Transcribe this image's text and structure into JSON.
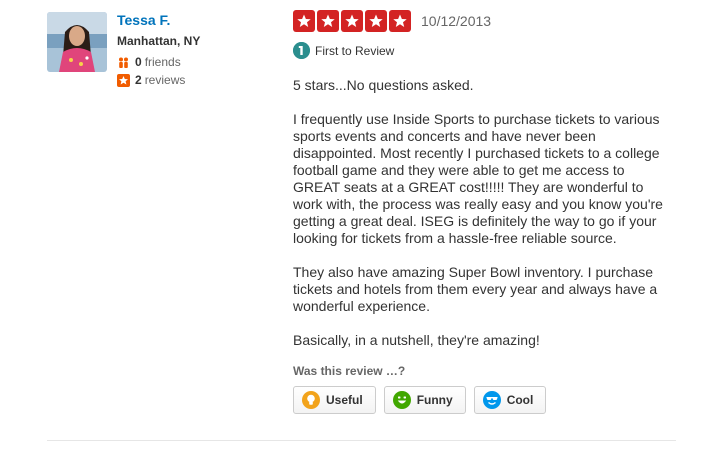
{
  "user": {
    "name": "Tessa F.",
    "location": "Manhattan, NY",
    "friends_count": "0",
    "friends_label": "friends",
    "reviews_count": "2",
    "reviews_label": "reviews"
  },
  "review": {
    "rating": 5,
    "date": "10/12/2013",
    "badge_label": "First to Review",
    "paragraphs": [
      "5 stars...No questions asked.",
      "I frequently use Inside Sports to purchase tickets to various sports events and concerts and have never been disappointed. Most recently I purchased tickets to a college football game and they were able to get me access to GREAT seats at a GREAT cost!!!!! They are wonderful to work with, the process was really easy and you know you're getting a great deal. ISEG is definitely the way to go if your looking for tickets from a hassle-free reliable source.",
      "They also have amazing Super Bowl inventory. I purchase tickets and hotels from them every year and always have a wonderful experience.",
      "Basically, in a nutshell, they're amazing!"
    ],
    "was_this_label": "Was this review …?",
    "votes": {
      "useful": "Useful",
      "funny": "Funny",
      "cool": "Cool"
    }
  },
  "colors": {
    "star_red": "#d32323",
    "link_blue": "#0073bb",
    "useful_orange": "#f2a31b",
    "funny_green": "#41a700",
    "cool_blue": "#0097ec"
  },
  "icons": {
    "friends": "friends-icon",
    "reviews": "star-badge-icon",
    "first_to_review": "first-to-review-icon",
    "useful": "lightbulb-icon",
    "funny": "smile-icon",
    "cool": "sunglasses-icon"
  }
}
